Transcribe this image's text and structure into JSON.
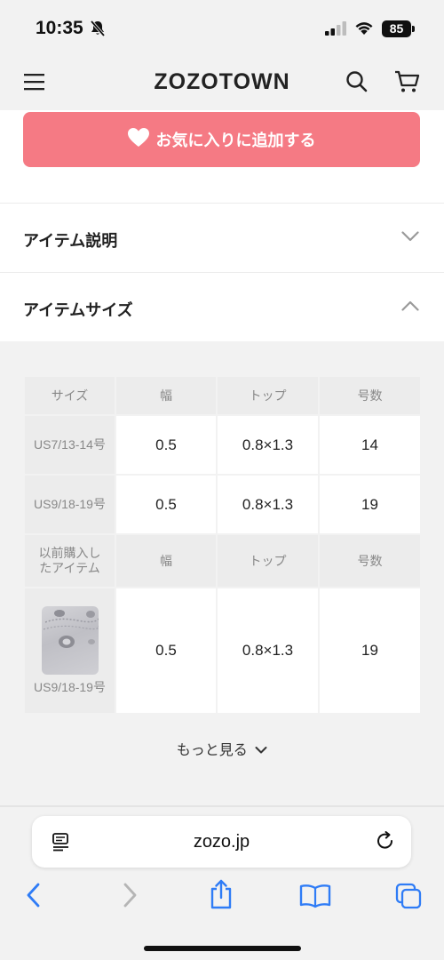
{
  "status_bar": {
    "time": "10:35",
    "battery": "85"
  },
  "header": {
    "logo": "ZOZOTOWN"
  },
  "favorite_button": {
    "label": "お気に入りに追加する"
  },
  "accordions": {
    "item_description": "アイテム説明",
    "item_size": "アイテムサイズ"
  },
  "size_table": {
    "headers": [
      "サイズ",
      "幅",
      "トップ",
      "号数"
    ],
    "rows": [
      {
        "size": "US7/13-14号",
        "width": "0.5",
        "top": "0.8×1.3",
        "number": "14"
      },
      {
        "size": "US9/18-19号",
        "width": "0.5",
        "top": "0.8×1.3",
        "number": "19"
      }
    ],
    "purchased_header": [
      "以前購入したアイテム",
      "幅",
      "トップ",
      "号数"
    ],
    "purchased_row": {
      "size": "US9/18-19号",
      "width": "0.5",
      "top": "0.8×1.3",
      "number": "19"
    }
  },
  "more_link": "もっと見る",
  "safari": {
    "url": "zozo.jp"
  },
  "colors": {
    "favorite_button": "#f57a84",
    "ios_blue": "#2f7cf6",
    "disabled_gray": "#b5b5b5"
  },
  "icons": [
    "bell-off-icon",
    "signal-icon",
    "wifi-icon",
    "hamburger-icon",
    "search-icon",
    "cart-icon",
    "heart-icon",
    "chevron-down-icon",
    "chevron-up-icon",
    "reader-icon",
    "reload-icon",
    "back-icon",
    "forward-icon",
    "share-icon",
    "bookmarks-icon",
    "tabs-icon"
  ]
}
